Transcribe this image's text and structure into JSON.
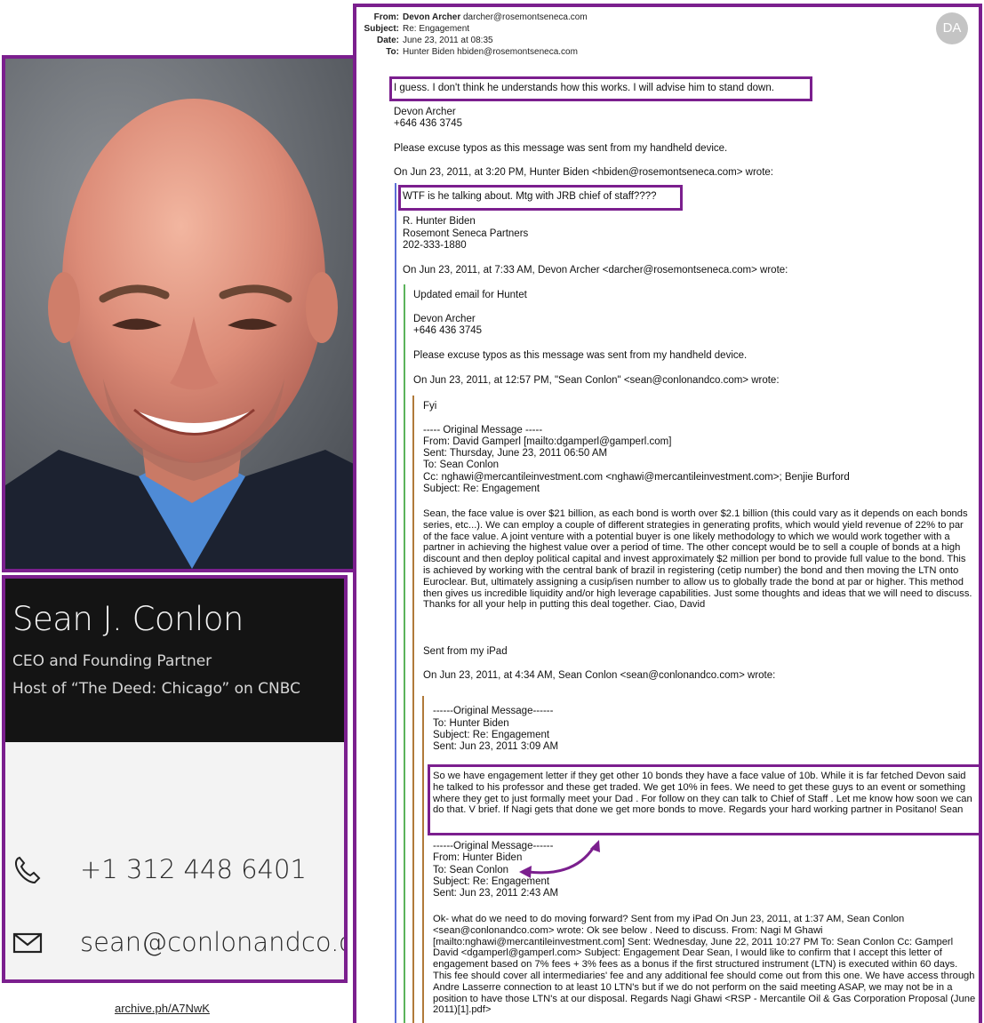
{
  "card": {
    "name": "Sean J. Conlon",
    "title_line1": "CEO and Founding Partner",
    "title_line2": "Host of “The Deed: Chicago” on CNBC",
    "phone": "+1 312 448 6401",
    "email": "sean@conlonandco.com"
  },
  "archive_link": "archive.ph/A7NwK",
  "email": {
    "avatar": "DA",
    "from_label": "From:",
    "from_name": "Devon Archer",
    "from_addr": "darcher@rosemontseneca.com",
    "subject_label": "Subject:",
    "subject": "Re: Engagement",
    "date_label": "Date:",
    "date": "June 23, 2011 at 08:35",
    "to_label": "To:",
    "to": "Hunter Biden hbiden@rosemontseneca.com",
    "body": {
      "l1": "I guess.  I don't think he understands how this works.  I will advise him to stand down.",
      "l2": "Devon Archer",
      "l3": "+646 436 3745",
      "l4": "Please excuse typos as this message was sent from my handheld device.",
      "l5": "On Jun 23, 2011, at 3:20 PM, Hunter Biden <hbiden@rosemontseneca.com> wrote:",
      "l6": "WTF is he talking about.  Mtg with JRB chief of staff????",
      "l7": "R. Hunter Biden",
      "l8": "Rosemont Seneca Partners",
      "l9": "202-333-1880",
      "l10": "On Jun 23, 2011, at 7:33 AM, Devon Archer <darcher@rosemontseneca.com> wrote:",
      "l11": "Updated email for Huntet",
      "l12": "Devon Archer",
      "l13": "+646 436 3745",
      "l14": "Please excuse typos as this message was sent from my handheld device.",
      "l15": "On Jun 23, 2011, at 12:57 PM, \"Sean Conlon\" <sean@conlonandco.com> wrote:",
      "l16": "Fyi",
      "l17": "----- Original Message -----",
      "l18": "From: David Gamperl [mailto:dgamperl@gamperl.com]",
      "l19": "Sent: Thursday, June 23, 2011 06:50 AM",
      "l20": "To: Sean Conlon",
      "l21": "Cc: nghawi@mercantileinvestment.com <nghawi@mercantileinvestment.com>; Benjie Burford",
      "l22": "Subject: Re: Engagement",
      "para1": "Sean, the face value is over $21 billion, as each bond is worth over $2.1 billion (this could vary as it depends on each bonds series, etc...).  We can employ a couple of different strategies in generating profits, which would yield revenue of 22% to par of the face value.  A joint venture with a potential buyer is one likely methodology to which we would work together with a partner in achieving the highest value over a period of time.  The other concept would be to sell a couple of bonds at a high discount and then deploy political capital and invest approximately $2 million per bond to provide full value to the bond.  This is achieved by working with the central bank of brazil in registering (cetip number) the bond and then moving the LTN onto Euroclear.  But, ultimately assigning a cusip/isen number to allow us to globally trade the bond at par or higher.  This method then gives us incredible liquidity and/or high leverage capabilities.  Just some thoughts and ideas that we will need to discuss. Thanks for all your help in putting this deal together. Ciao, David",
      "l23": "Sent from my iPad",
      "l24": "On Jun 23, 2011, at 4:34 AM, Sean Conlon <sean@conlonandco.com> wrote:",
      "l25": "------Original Message------",
      "l26": "To: Hunter Biden",
      "l27": "Subject: Re: Engagement",
      "l28": "Sent: Jun 23, 2011 3:09 AM",
      "para2": "So we have engagement letter if they get other 10 bonds they have a face value of 10b. While it is far fetched Devon said he talked to his professor and these get traded. We get 10% in fees. We need to get these guys to an event or something where they get to just formally meet your Dad . For follow on they can talk to Chief of Staff . Let me know how soon we can do that. V brief. If Nagi gets that done we get more bonds to move. Regards your hard working partner in Positano! Sean",
      "l29": "------Original Message------",
      "l30": "From: Hunter Biden",
      "l31": "To: Sean Conlon",
      "l32": "Subject: Re: Engagement",
      "l33": "Sent: Jun 23, 2011 2:43 AM",
      "para3": "Ok- what do we need to do moving forward? Sent from my iPad On Jun 23, 2011, at 1:37 AM, Sean Conlon <sean@conlonandco.com> wrote: Ok see below . Need to discuss.  From: Nagi M Ghawi [mailto:nghawi@mercantileinvestment.com] Sent: Wednesday, June 22, 2011 10:27 PM To: Sean Conlon Cc: Gamperl David <dgamperl@gamperl.com> Subject: Engagement  Dear Sean, I would like to confirm that I accept this letter of engagement based on 7% fees + 3% fees as a bonus if the first structured instrument (LTN) is executed within 60 days. This fee should cover all intermediaries' fee and any additional fee should come out from this one. We have access through Andre Lasserre connection to at least 10 LTN's but if we do not perform on the said meeting ASAP, we may not be in a position to have those LTN's at our disposal. Regards Nagi Ghawi <RSP - Mercantile Oil & Gas Corporation Proposal (June 2011)[1].pdf>"
    }
  }
}
